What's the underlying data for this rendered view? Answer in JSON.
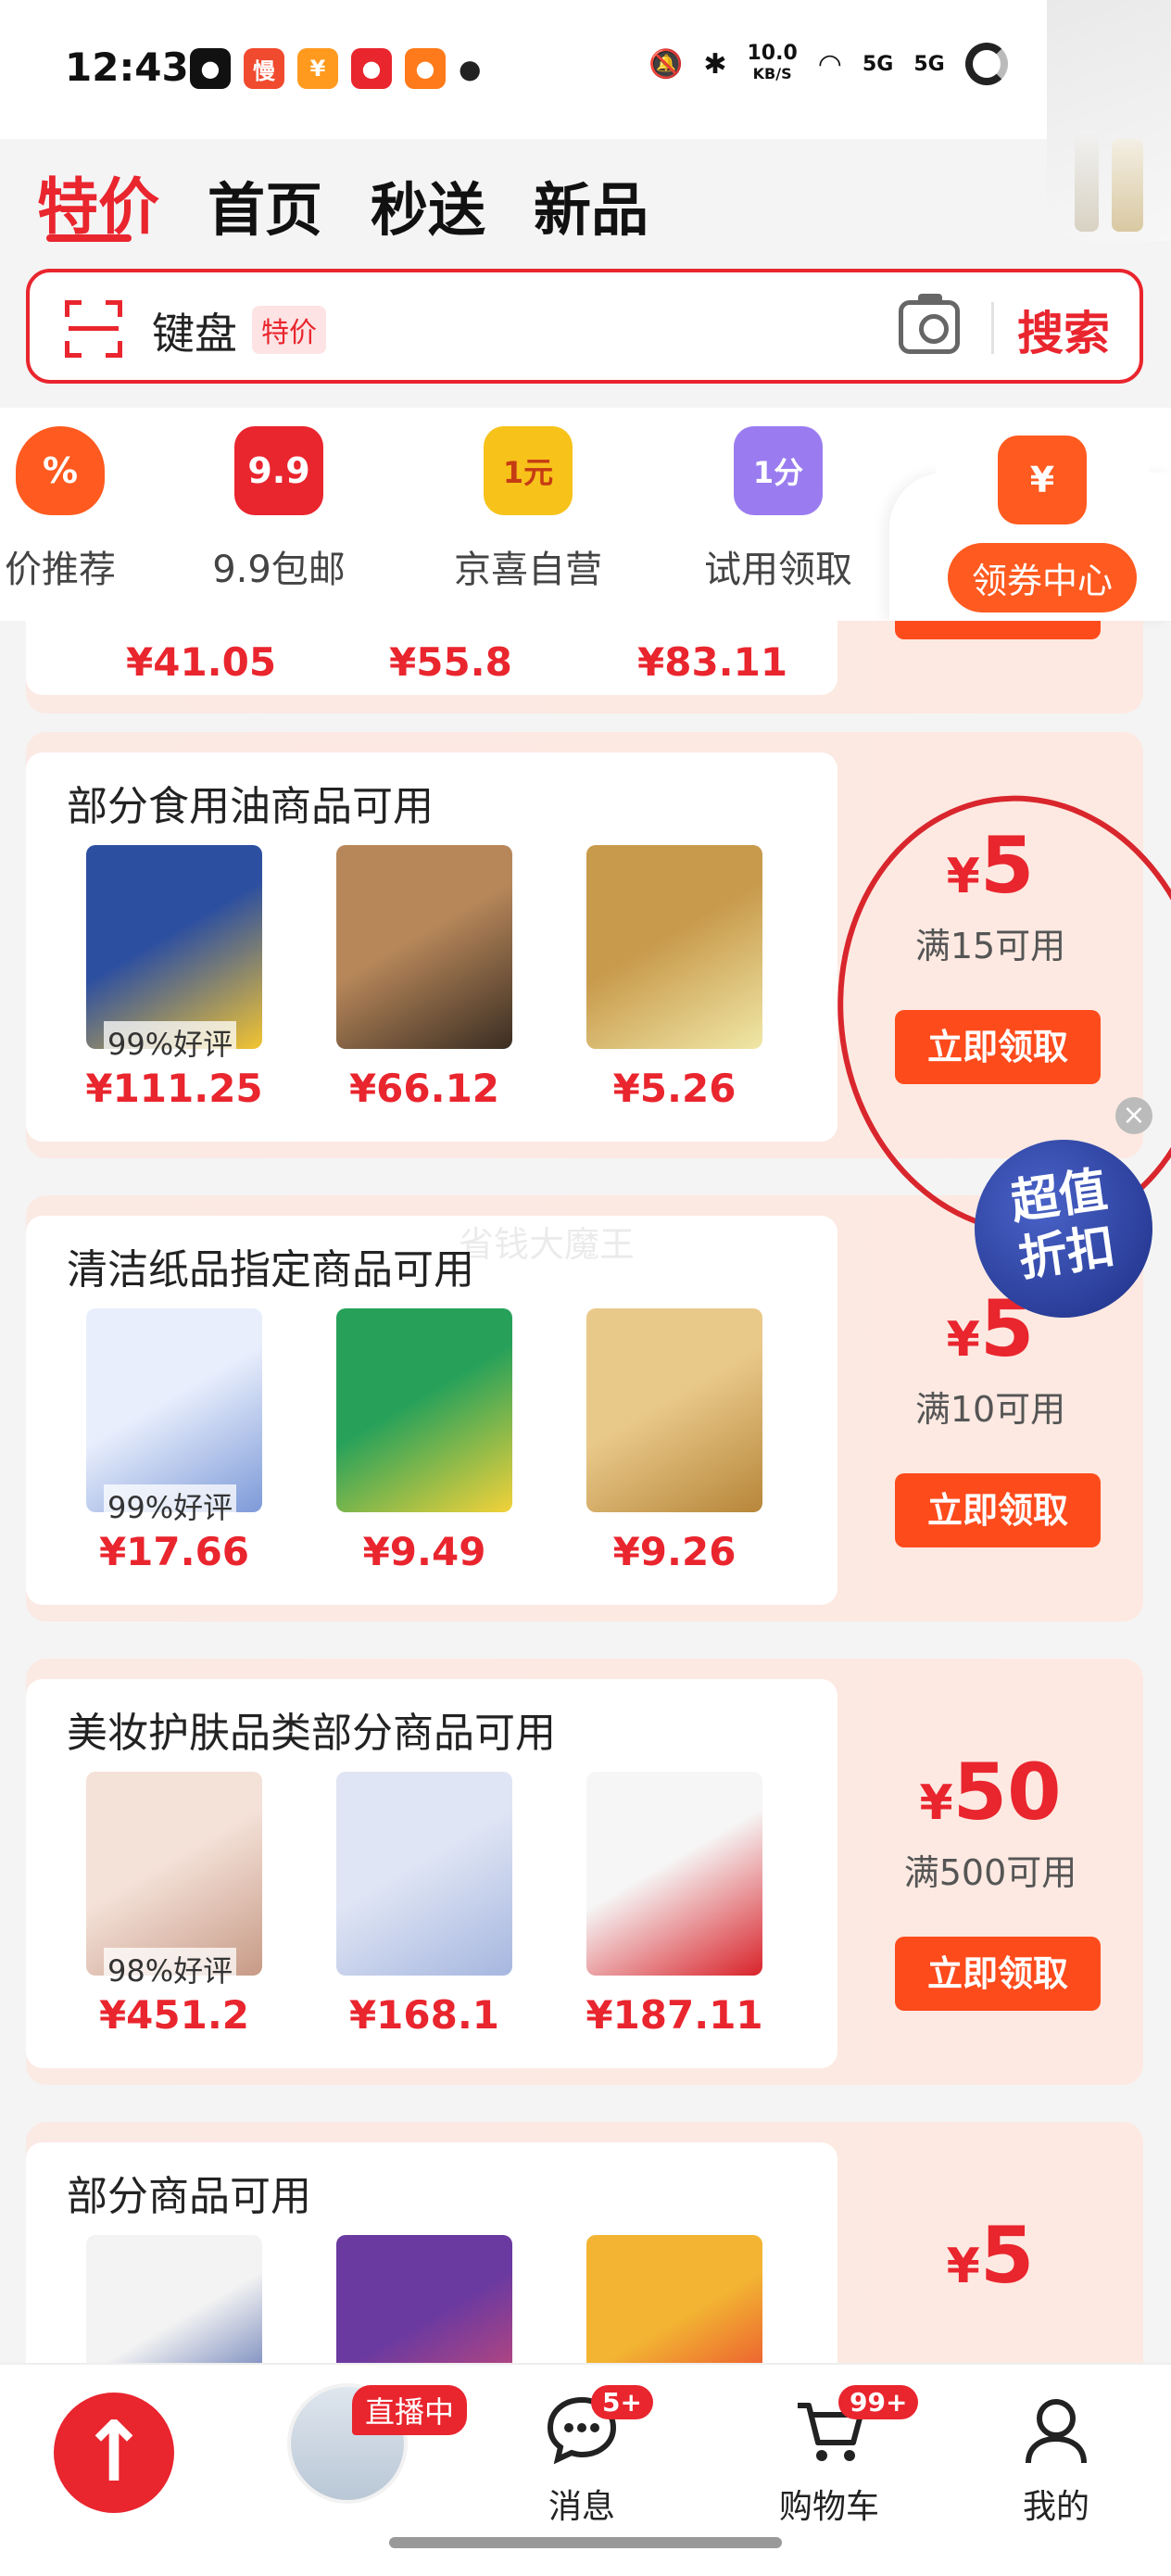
{
  "status_bar": {
    "time": "12:43",
    "net_speed": "10.0",
    "net_unit": "KB/S",
    "net_5g_a": "5G",
    "net_5g_b": "5G"
  },
  "tabs": [
    "特价",
    "首页",
    "秒送",
    "新品"
  ],
  "search": {
    "keyword": "键盘",
    "tag": "特价",
    "button": "搜索"
  },
  "categories": [
    {
      "label": "价推荐",
      "icon": "percent-icon",
      "glyph": "%",
      "color": "#ff5a1f"
    },
    {
      "label": "9.9包邮",
      "icon": "gift-box-icon",
      "glyph": "9.9",
      "color": "#e9252e"
    },
    {
      "label": "京喜自营",
      "icon": "yuan-badge-icon",
      "glyph": "1元",
      "color": "#f7c21a"
    },
    {
      "label": "试用领取",
      "icon": "shopping-bag-icon",
      "glyph": "1分",
      "color": "#9a7cf0"
    },
    {
      "label": "领券中心",
      "icon": "coupon-icon",
      "glyph": "¥",
      "color": "#ff5a1f"
    }
  ],
  "partial_coupon": {
    "prices": [
      "¥41.05",
      "¥55.8",
      "¥83.11"
    ]
  },
  "coupons": [
    {
      "title": "部分食用油商品可用",
      "amount_symbol": "¥",
      "amount": "5",
      "condition": "满15可用",
      "claim": "立即领取",
      "products": [
        {
          "rating": "99%好评",
          "price": "¥111.25",
          "colors": [
            "#2d4fa0",
            "#f3c531"
          ]
        },
        {
          "rating": "",
          "price": "¥66.12",
          "colors": [
            "#b7875a",
            "#3a2d22"
          ]
        },
        {
          "rating": "",
          "price": "¥5.26",
          "colors": [
            "#c89a4c",
            "#f0e7a6"
          ]
        }
      ]
    },
    {
      "title": "清洁纸品指定商品可用",
      "amount_symbol": "¥",
      "amount": "5",
      "condition": "满10可用",
      "claim": "立即领取",
      "products": [
        {
          "rating": "99%好评",
          "price": "¥17.66",
          "colors": [
            "#e8eefc",
            "#7d9ad8"
          ]
        },
        {
          "rating": "",
          "price": "¥9.49",
          "colors": [
            "#27a15a",
            "#f3d23a"
          ]
        },
        {
          "rating": "",
          "price": "¥9.26",
          "colors": [
            "#e9c98a",
            "#b7863a"
          ]
        }
      ]
    },
    {
      "title": "美妆护肤品类部分商品可用",
      "amount_symbol": "¥",
      "amount": "50",
      "condition": "满500可用",
      "claim": "立即领取",
      "products": [
        {
          "rating": "98%好评",
          "price": "¥451.2",
          "colors": [
            "#f4e1d8",
            "#c79a86"
          ]
        },
        {
          "rating": "",
          "price": "¥168.1",
          "colors": [
            "#dfe5f4",
            "#a6b6df"
          ]
        },
        {
          "rating": "",
          "price": "¥187.11",
          "colors": [
            "#f6f6f6",
            "#d8232a"
          ]
        }
      ]
    },
    {
      "title": "部分商品可用",
      "amount_symbol": "¥",
      "amount": "5",
      "condition": "",
      "claim": "",
      "products": [
        {
          "rating": "",
          "price": "",
          "colors": [
            "#f3f3f3",
            "#2e4a9c"
          ]
        },
        {
          "rating": "",
          "price": "",
          "colors": [
            "#6b3aa0",
            "#e44d6b"
          ]
        },
        {
          "rating": "",
          "price": "",
          "colors": [
            "#f2b432",
            "#e9252e"
          ]
        }
      ]
    }
  ],
  "badge": {
    "line1": "超值",
    "line2": "折扣"
  },
  "watermark": "省钱大魔王",
  "bottom_nav": {
    "live_tag": "直播中",
    "items": [
      {
        "label": "消息",
        "count": "5+",
        "icon": "message-icon"
      },
      {
        "label": "购物车",
        "count": "99+",
        "icon": "cart-icon"
      },
      {
        "label": "我的",
        "count": "",
        "icon": "user-icon"
      }
    ]
  }
}
